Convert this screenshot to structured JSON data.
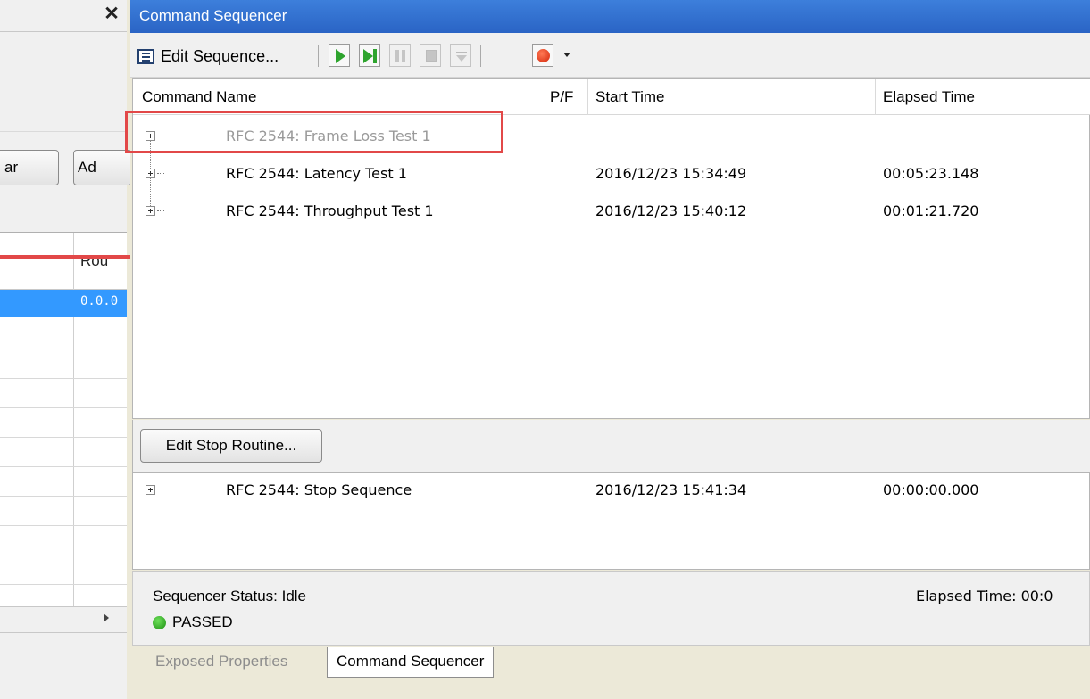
{
  "left_panel": {
    "close_glyph": "✕",
    "buttons": [
      "ar",
      "Ad"
    ],
    "column_header": "Rou",
    "selected_cell": "0.0.0"
  },
  "sequencer": {
    "title": "Command Sequencer",
    "toolbar": {
      "edit_sequence": "Edit Sequence...",
      "icons": [
        "edit-sequence-icon",
        "run-icon",
        "run-to-end-icon",
        "pause-icon",
        "stop-icon",
        "step-icon",
        "record-icon",
        "dropdown-icon"
      ]
    },
    "columns": {
      "name": "Command Name",
      "pf": "P/F",
      "start": "Start Time",
      "elapsed": "Elapsed Time"
    },
    "commands": [
      {
        "name": "RFC 2544: Frame Loss Test 1",
        "start": "",
        "elapsed": "",
        "disabled": true
      },
      {
        "name": "RFC 2544: Latency Test 1",
        "start": "2016/12/23 15:34:49",
        "elapsed": "00:05:23.148",
        "disabled": false
      },
      {
        "name": "RFC 2544: Throughput Test 1",
        "start": "2016/12/23 15:40:12",
        "elapsed": "00:01:21.720",
        "disabled": false
      }
    ],
    "edit_stop_routine": "Edit Stop Routine...",
    "stop_commands": [
      {
        "name": "RFC 2544: Stop Sequence",
        "start": "2016/12/23 15:41:34",
        "elapsed": "00:00:00.000"
      }
    ],
    "status": {
      "text": "Sequencer Status: Idle",
      "elapsed": "Elapsed Time: 00:0",
      "result": "PASSED",
      "result_color": "#2aa21e"
    }
  },
  "tabs": [
    "Exposed Properties",
    "Command Sequencer"
  ],
  "annotation_color": "#e24848"
}
